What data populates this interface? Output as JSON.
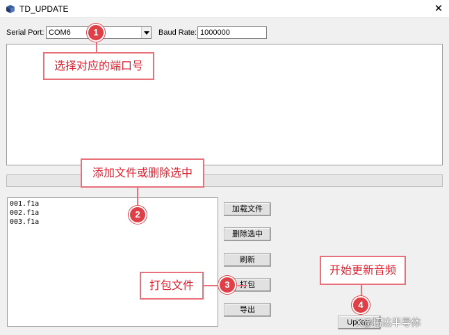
{
  "window": {
    "title": "TD_UPDATE",
    "icons": {
      "app": "cube-icon",
      "close": "close-icon"
    }
  },
  "serial": {
    "label": "Serial Port:",
    "value": "COM6"
  },
  "baud": {
    "label": "Baud Rate:",
    "value": "1000000"
  },
  "progress": {
    "percent": 0
  },
  "files": [
    "001.f1a",
    "002.f1a",
    "003.f1a"
  ],
  "buttons": {
    "add_file": "加载文件",
    "delete_selected": "删除选中",
    "refresh": "刷新",
    "pack": "打包",
    "export": "导出",
    "update": "Update"
  },
  "annotations": {
    "step1": {
      "number": "1",
      "text": "选择对应的端口号"
    },
    "step2": {
      "number": "2",
      "text": "添加文件或删除选中"
    },
    "step3": {
      "number": "3",
      "text": "打包文件"
    },
    "step4": {
      "number": "4",
      "text": "开始更新音频"
    }
  },
  "watermark": "X@拓达半导体",
  "colors": {
    "annotation_red": "#e0212f",
    "marker_red": "#df3f47"
  }
}
